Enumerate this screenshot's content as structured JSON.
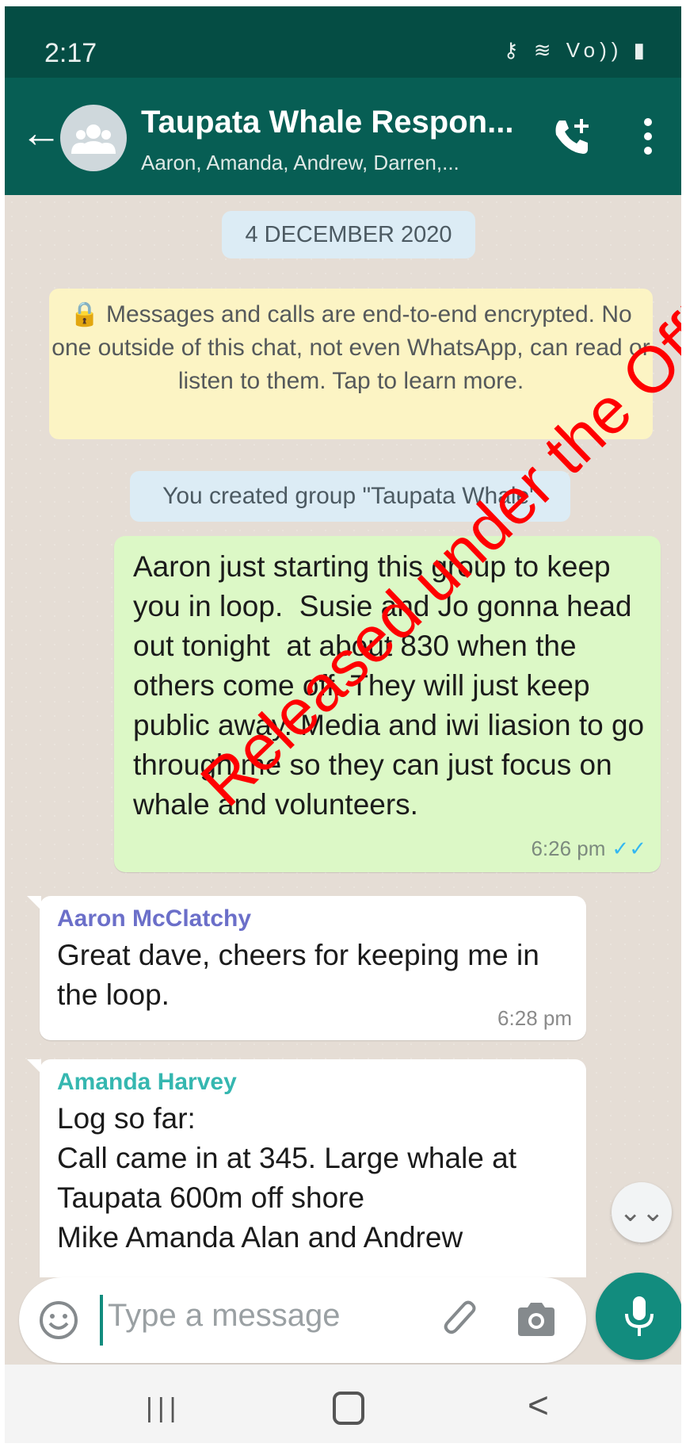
{
  "status_bar": {
    "time": "2:17",
    "icons": [
      "key-icon",
      "wifi-icon",
      "volte-icon",
      "signal-icon",
      "battery-icon"
    ],
    "icons_text": "⚷ ≋ Vo)) ▮"
  },
  "header": {
    "back": "←",
    "title": "Taupata Whale Respon...",
    "subtitle": "Aaron, Amanda, Andrew, Darren,...",
    "colors": {
      "bar": "#075e54",
      "status": "#054d44"
    }
  },
  "chat": {
    "date": "4 DECEMBER 2020",
    "encryption_notice": "🔒 Messages and calls are end-to-end encrypted. No one outside of this chat, not even WhatsApp, can read or listen to them. Tap to learn more.",
    "system_message": "You created group \"Taupata Whale\"",
    "messages": [
      {
        "direction": "outgoing",
        "text": "Aaron just starting this group to keep you in loop.  Susie and Jo gonna head out tonight  at about 830 when the others come off. They will just keep public away. Media and iwi liasion to go through me so they can just focus on whale and volunteers.",
        "time": "6:26 pm",
        "status": "✓✓"
      },
      {
        "direction": "incoming",
        "sender": "Aaron McClatchy",
        "sender_color": "#6b6fc9",
        "text": "Great dave, cheers for keeping me in the loop.",
        "time": "6:28 pm"
      },
      {
        "direction": "incoming",
        "sender": "Amanda Harvey",
        "sender_color": "#35b7b0",
        "text": "Log so far:\nCall came in at 345. Large whale at Taupata 600m off shore\nMike Amanda Alan and Andrew",
        "time": ""
      }
    ],
    "scroll_down": "⌄⌄"
  },
  "watermark": "Released under the Official Info",
  "composer": {
    "placeholder": "Type a message"
  },
  "nav": {
    "recents": "|||",
    "back": "<"
  }
}
